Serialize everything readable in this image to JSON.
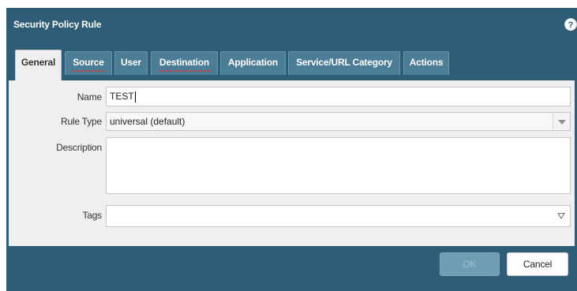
{
  "dialog": {
    "title": "Security Policy Rule",
    "help_icon": "help-icon",
    "help_glyph": "?"
  },
  "tabs": [
    {
      "label": "General",
      "active": true,
      "error": false
    },
    {
      "label": "Source",
      "active": false,
      "error": true
    },
    {
      "label": "User",
      "active": false,
      "error": false
    },
    {
      "label": "Destination",
      "active": false,
      "error": true
    },
    {
      "label": "Application",
      "active": false,
      "error": false
    },
    {
      "label": "Service/URL Category",
      "active": false,
      "error": false
    },
    {
      "label": "Actions",
      "active": false,
      "error": false
    }
  ],
  "form": {
    "name_label": "Name",
    "name_value": "TEST",
    "rule_type_label": "Rule Type",
    "rule_type_value": "universal (default)",
    "description_label": "Description",
    "description_value": "",
    "tags_label": "Tags",
    "tags_value": ""
  },
  "buttons": {
    "ok_label": "OK",
    "ok_enabled": false,
    "cancel_label": "Cancel"
  },
  "colors": {
    "dialog_bg": "#2d5d77",
    "tab_bg": "#4c7d97",
    "panel_bg": "#efefef",
    "error_underline": "#e0372e"
  }
}
